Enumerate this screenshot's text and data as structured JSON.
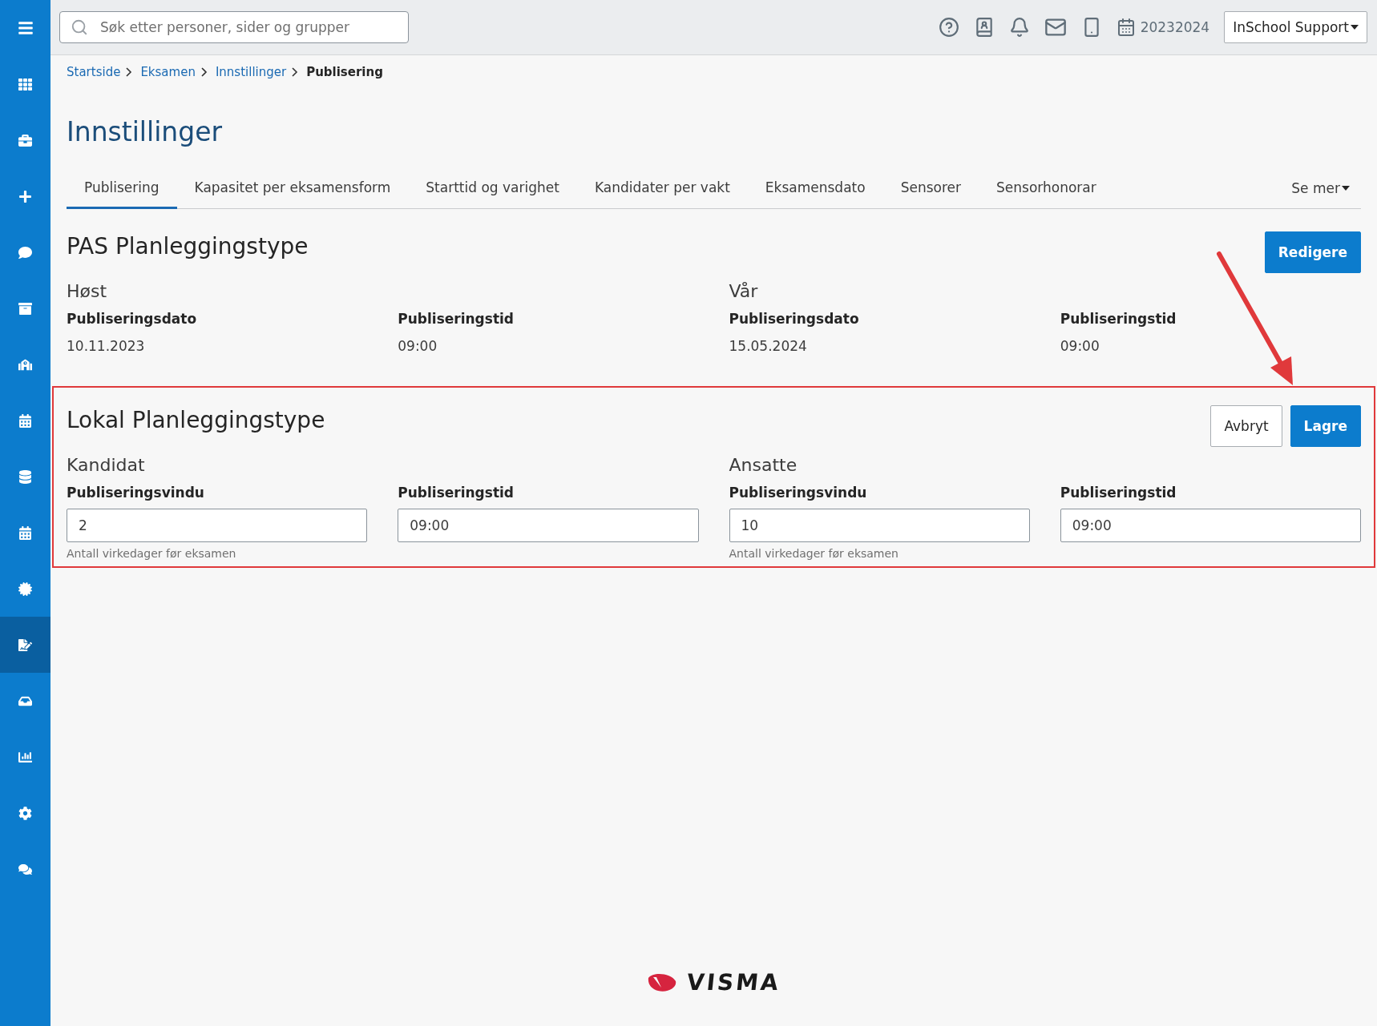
{
  "sidebar": {
    "items": [
      {
        "selected": false
      },
      {
        "selected": false
      },
      {
        "selected": false
      },
      {
        "selected": false
      },
      {
        "selected": false
      },
      {
        "selected": false
      },
      {
        "selected": false
      },
      {
        "selected": false
      },
      {
        "selected": false
      },
      {
        "selected": false
      },
      {
        "selected": false
      },
      {
        "selected": true
      },
      {
        "selected": false
      },
      {
        "selected": false
      },
      {
        "selected": false
      },
      {
        "selected": false
      }
    ]
  },
  "search": {
    "placeholder": "Søk etter personer, sider og grupper"
  },
  "topbar": {
    "school_year": "20232024",
    "user_menu": "InSchool Support"
  },
  "breadcrumb": [
    {
      "label": "Startside",
      "current": false
    },
    {
      "label": "Eksamen",
      "current": false
    },
    {
      "label": "Innstillinger",
      "current": false
    },
    {
      "label": "Publisering",
      "current": true
    }
  ],
  "page_title": "Innstillinger",
  "tabs": [
    {
      "label": "Publisering",
      "selected": true
    },
    {
      "label": "Kapasitet per eksamensform",
      "selected": false
    },
    {
      "label": "Starttid og varighet",
      "selected": false
    },
    {
      "label": "Kandidater per vakt",
      "selected": false
    },
    {
      "label": "Eksamensdato",
      "selected": false
    },
    {
      "label": "Sensorer",
      "selected": false
    },
    {
      "label": "Sensorhonorar",
      "selected": false
    }
  ],
  "more_tab": "Se mer",
  "pas_section": {
    "title": "PAS Planleggingstype",
    "button": "Redigere",
    "groups": [
      {
        "heading": "Høst",
        "fields": [
          {
            "label": "Publiseringsdato",
            "value": "10.11.2023"
          },
          {
            "label": "Publiseringstid",
            "value": "09:00"
          }
        ]
      },
      {
        "heading": "Vår",
        "fields": [
          {
            "label": "Publiseringsdato",
            "value": "15.05.2024"
          },
          {
            "label": "Publiseringstid",
            "value": "09:00"
          }
        ]
      }
    ]
  },
  "local_section": {
    "title": "Lokal Planleggingstype",
    "highlighted": true,
    "buttons": [
      {
        "label": "Avbryt",
        "kind": "secondary"
      },
      {
        "label": "Lagre",
        "kind": "primary"
      }
    ],
    "groups": [
      {
        "heading": "Kandidat",
        "fields": [
          {
            "label": "Publiseringsvindu",
            "value": "2",
            "hint": "Antall virkedager før eksamen"
          },
          {
            "label": "Publiseringstid",
            "value": "09:00"
          }
        ]
      },
      {
        "heading": "Ansatte",
        "fields": [
          {
            "label": "Publiseringsvindu",
            "value": "10",
            "hint": "Antall virkedager før eksamen"
          },
          {
            "label": "Publiseringstid",
            "value": "09:00"
          }
        ]
      }
    ]
  },
  "footer": {
    "logo": "VISMA"
  }
}
